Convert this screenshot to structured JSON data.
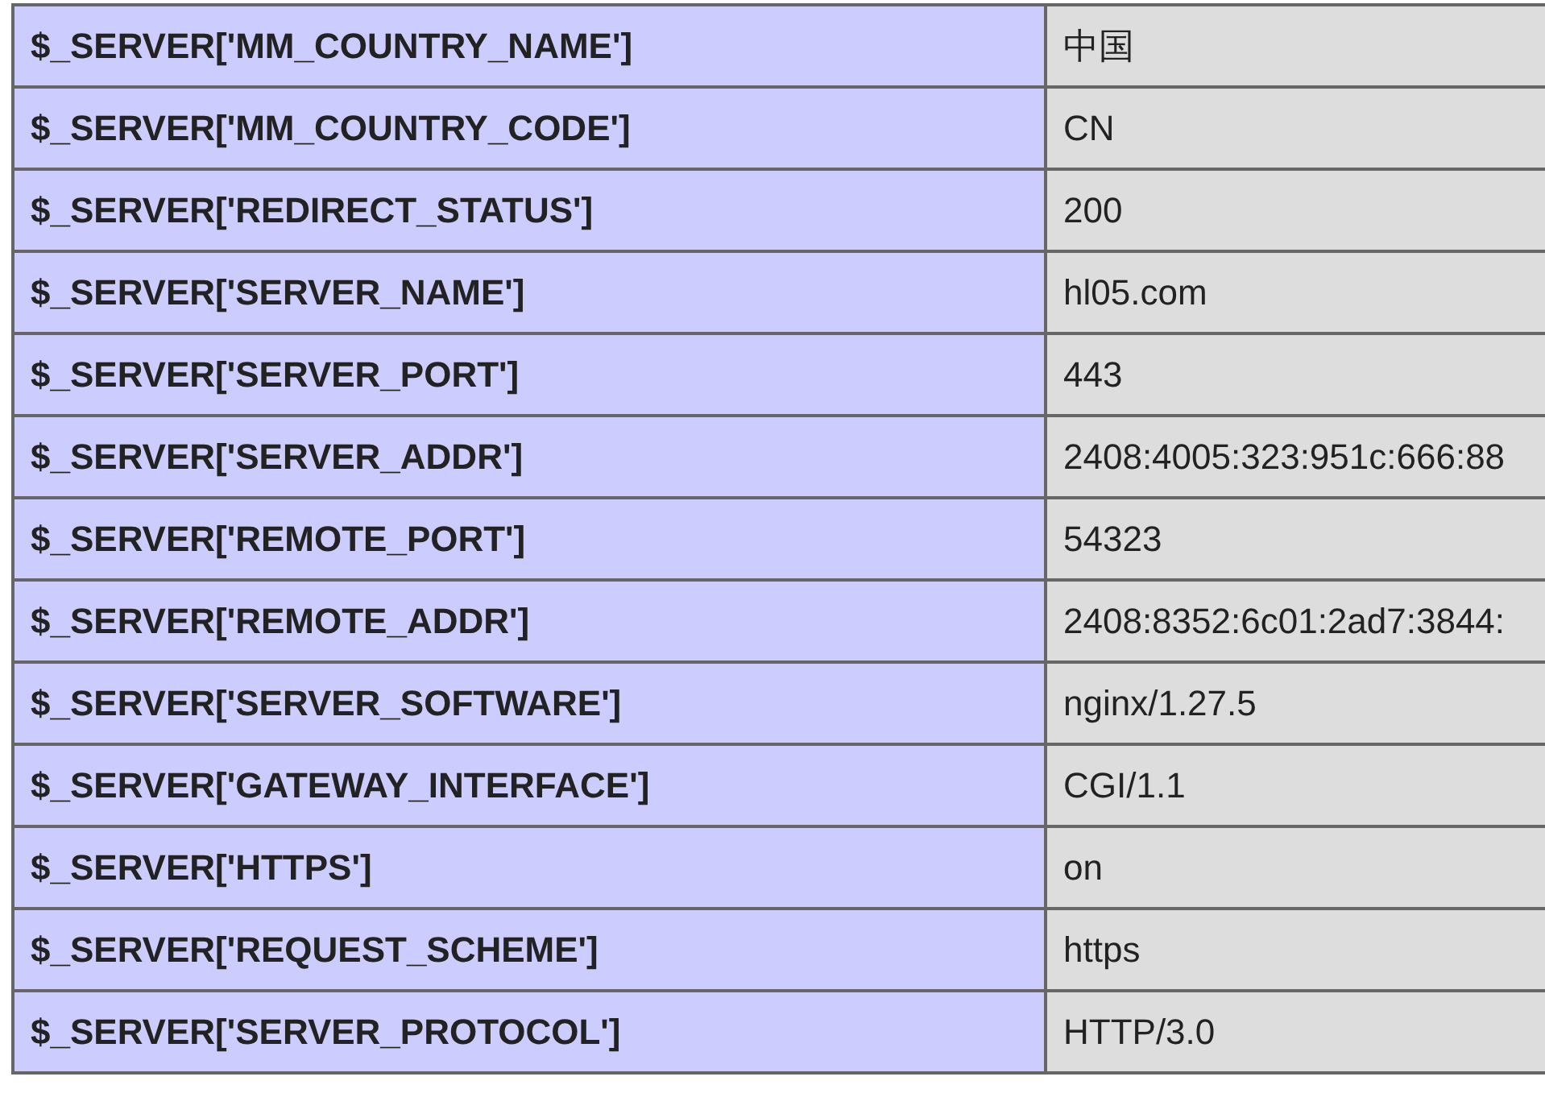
{
  "table": {
    "rows": [
      {
        "name": "$_SERVER['MM_COUNTRY_NAME']",
        "value": "中国"
      },
      {
        "name": "$_SERVER['MM_COUNTRY_CODE']",
        "value": "CN"
      },
      {
        "name": "$_SERVER['REDIRECT_STATUS']",
        "value": "200"
      },
      {
        "name": "$_SERVER['SERVER_NAME']",
        "value": "hl05.com"
      },
      {
        "name": "$_SERVER['SERVER_PORT']",
        "value": "443"
      },
      {
        "name": "$_SERVER['SERVER_ADDR']",
        "value": "2408:4005:323:951c:666:88"
      },
      {
        "name": "$_SERVER['REMOTE_PORT']",
        "value": "54323"
      },
      {
        "name": "$_SERVER['REMOTE_ADDR']",
        "value": "2408:8352:6c01:2ad7:3844:"
      },
      {
        "name": "$_SERVER['SERVER_SOFTWARE']",
        "value": "nginx/1.27.5"
      },
      {
        "name": "$_SERVER['GATEWAY_INTERFACE']",
        "value": "CGI/1.1"
      },
      {
        "name": "$_SERVER['HTTPS']",
        "value": "on"
      },
      {
        "name": "$_SERVER['REQUEST_SCHEME']",
        "value": "https"
      },
      {
        "name": "$_SERVER['SERVER_PROTOCOL']",
        "value": "HTTP/3.0"
      }
    ]
  }
}
